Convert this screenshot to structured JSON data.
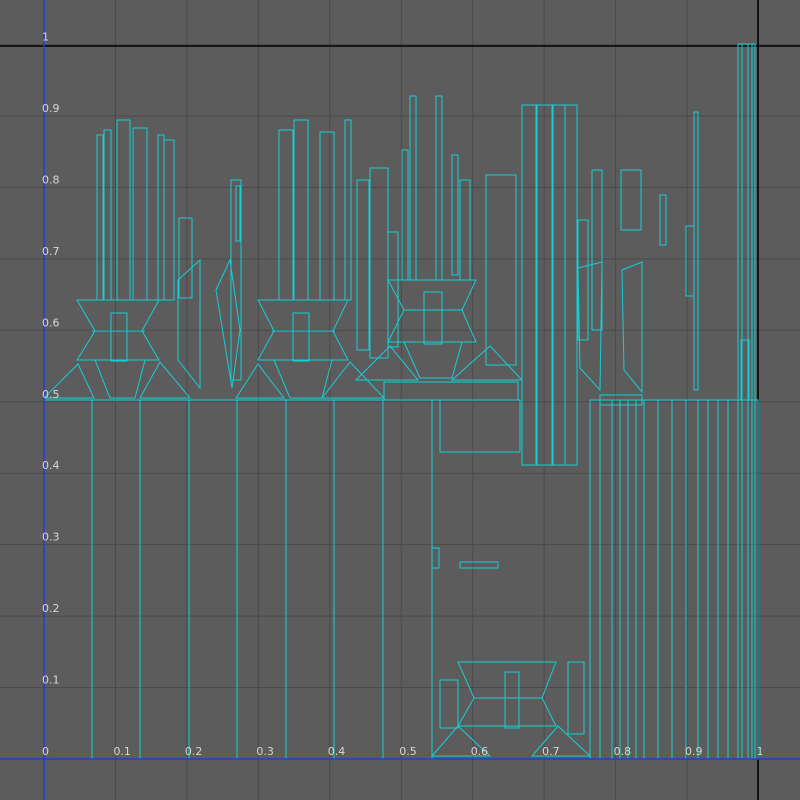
{
  "uv_editor": {
    "axis_labels_x": [
      "0",
      "0.1",
      "0.2",
      "0.3",
      "0.4",
      "0.5",
      "0.6",
      "0.7",
      "0.8",
      "0.9",
      "1"
    ],
    "axis_labels_y": [
      "0",
      "0.1",
      "0.2",
      "0.3",
      "0.4",
      "0.5",
      "0.6",
      "0.7",
      "0.8",
      "0.9",
      "1"
    ],
    "colors": {
      "background": "#5c5c5c",
      "grid": "#4a4a4a",
      "uv_wireframe": "#13cfd6",
      "axis_u": "#1e3fd6",
      "boundary": "#000000",
      "label": "#d6d6d6"
    }
  }
}
